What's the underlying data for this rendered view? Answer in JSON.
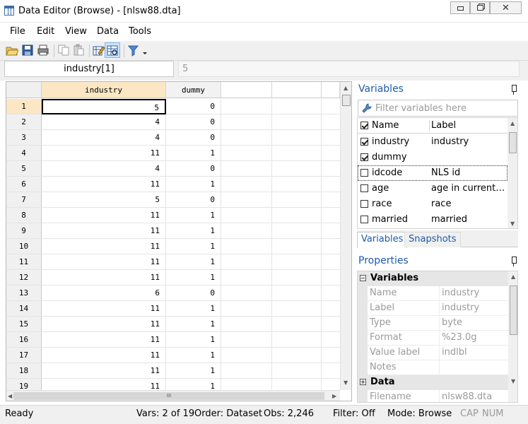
{
  "window": {
    "title": "Data Editor (Browse) - [nlsw88.dta]",
    "minimize_icon": "minimize-icon",
    "maximize_icon": "restore-icon",
    "close_glyph": "✕"
  },
  "menu": [
    "File",
    "Edit",
    "View",
    "Data",
    "Tools"
  ],
  "toolbar": {
    "icons": [
      "open-icon",
      "save-icon",
      "print-icon",
      "copy-icon",
      "paste-icon",
      "edit-mode-icon",
      "browse-mode-icon",
      "filter-icon"
    ]
  },
  "cellbar": {
    "cell_name": "industry[1]",
    "cell_value": "5"
  },
  "grid": {
    "columns": [
      "industry",
      "dummy"
    ],
    "rows": [
      {
        "n": "1",
        "industry": "5",
        "dummy": "0"
      },
      {
        "n": "2",
        "industry": "4",
        "dummy": "0"
      },
      {
        "n": "3",
        "industry": "4",
        "dummy": "0"
      },
      {
        "n": "4",
        "industry": "11",
        "dummy": "1"
      },
      {
        "n": "5",
        "industry": "4",
        "dummy": "0"
      },
      {
        "n": "6",
        "industry": "11",
        "dummy": "1"
      },
      {
        "n": "7",
        "industry": "5",
        "dummy": "0"
      },
      {
        "n": "8",
        "industry": "11",
        "dummy": "1"
      },
      {
        "n": "9",
        "industry": "11",
        "dummy": "1"
      },
      {
        "n": "10",
        "industry": "11",
        "dummy": "1"
      },
      {
        "n": "11",
        "industry": "11",
        "dummy": "1"
      },
      {
        "n": "12",
        "industry": "11",
        "dummy": "1"
      },
      {
        "n": "13",
        "industry": "6",
        "dummy": "0"
      },
      {
        "n": "14",
        "industry": "11",
        "dummy": "1"
      },
      {
        "n": "15",
        "industry": "11",
        "dummy": "1"
      },
      {
        "n": "16",
        "industry": "11",
        "dummy": "1"
      },
      {
        "n": "17",
        "industry": "11",
        "dummy": "1"
      },
      {
        "n": "18",
        "industry": "11",
        "dummy": "1"
      },
      {
        "n": "19",
        "industry": "11",
        "dummy": "1"
      }
    ],
    "hscroll_grip": "III"
  },
  "variables_panel": {
    "title": "Variables",
    "filter_placeholder": "Filter variables here",
    "header": {
      "name": "Name",
      "label": "Label"
    },
    "items": [
      {
        "name": "industry",
        "label": "industry",
        "checked": true
      },
      {
        "name": "dummy",
        "label": "",
        "checked": true
      },
      {
        "name": "idcode",
        "label": "NLS id",
        "checked": false
      },
      {
        "name": "age",
        "label": "age in current year",
        "checked": false
      },
      {
        "name": "race",
        "label": "race",
        "checked": false
      },
      {
        "name": "married",
        "label": "married",
        "checked": false
      }
    ],
    "tabs": [
      "Variables",
      "Snapshots"
    ]
  },
  "properties_panel": {
    "title": "Properties",
    "groups": [
      {
        "name": "Variables",
        "rows": [
          {
            "key": "Name",
            "value": "industry"
          },
          {
            "key": "Label",
            "value": "industry"
          },
          {
            "key": "Type",
            "value": "byte"
          },
          {
            "key": "Format",
            "value": "%23.0g"
          },
          {
            "key": "Value label",
            "value": "indlbl"
          },
          {
            "key": "Notes",
            "value": ""
          }
        ]
      },
      {
        "name": "Data",
        "rows": [
          {
            "key": "Filename",
            "value": "nlsw88.dta"
          }
        ]
      }
    ]
  },
  "status": {
    "ready": "Ready",
    "vars": "Vars: 2 of 19",
    "order": "Order: Dataset",
    "obs": "Obs: 2,246",
    "filter": "Filter: Off",
    "mode": "Mode: Browse",
    "cap": "CAP",
    "num": "NUM"
  }
}
